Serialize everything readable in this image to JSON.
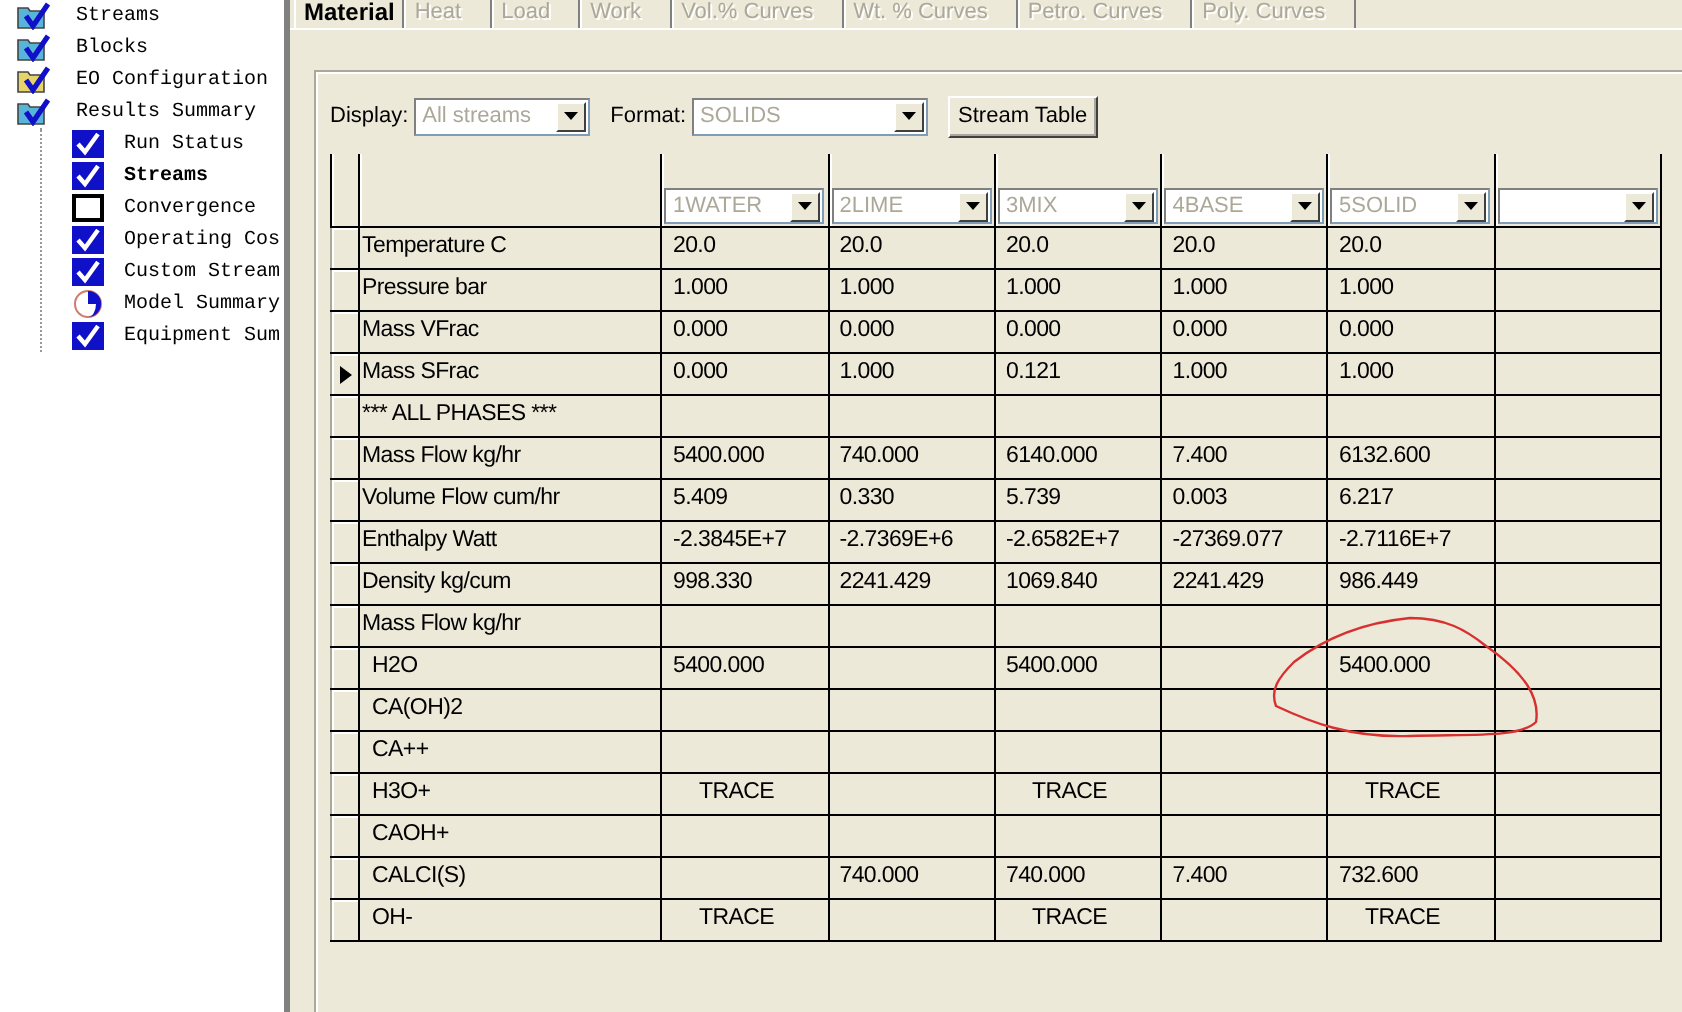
{
  "tree": [
    {
      "label": "Streams",
      "color": "#58b4d8",
      "checked": true,
      "selected": false
    },
    {
      "label": "Blocks",
      "color": "#58b4d8",
      "checked": true,
      "selected": false
    },
    {
      "label": "EO Configuration",
      "color": "#e6d46a",
      "checked": true,
      "selected": false
    },
    {
      "label": "Results Summary",
      "color": "#58b4d8",
      "checked": true,
      "selected": false,
      "children": [
        {
          "label": "Run Status",
          "checked": true,
          "partial": false,
          "selected": false
        },
        {
          "label": "Streams",
          "checked": true,
          "partial": false,
          "selected": true
        },
        {
          "label": "Convergence",
          "checked": false,
          "partial": false,
          "selected": false
        },
        {
          "label": "Operating Cos",
          "checked": true,
          "partial": false,
          "selected": false
        },
        {
          "label": "Custom Stream",
          "checked": true,
          "partial": false,
          "selected": false
        },
        {
          "label": "Model Summary",
          "checked": false,
          "partial": true,
          "selected": false
        },
        {
          "label": "Equipment Sum",
          "checked": true,
          "partial": false,
          "selected": false
        }
      ]
    }
  ],
  "tabs": [
    {
      "label": "Material",
      "selected": true,
      "disabled": false
    },
    {
      "label": "Heat",
      "selected": false,
      "disabled": true
    },
    {
      "label": "Load",
      "selected": false,
      "disabled": true
    },
    {
      "label": "Work",
      "selected": false,
      "disabled": true
    },
    {
      "label": "Vol.% Curves",
      "selected": false,
      "disabled": true
    },
    {
      "label": "Wt. % Curves",
      "selected": false,
      "disabled": true
    },
    {
      "label": "Petro. Curves",
      "selected": false,
      "disabled": true
    },
    {
      "label": "Poly. Curves",
      "selected": false,
      "disabled": true
    }
  ],
  "display": {
    "label": "Display:",
    "value": "All streams",
    "disabled": true
  },
  "format": {
    "label": "Format:",
    "value": "SOLIDS",
    "disabled": true
  },
  "stream_table_button": "Stream Table",
  "table": {
    "columns": [
      {
        "stream": "1WATER"
      },
      {
        "stream": "2LIME"
      },
      {
        "stream": "3MIX"
      },
      {
        "stream": "4BASE"
      },
      {
        "stream": "5SOLID"
      },
      {}
    ],
    "rows": [
      {
        "label": "Temperature C",
        "selected": false,
        "cells": [
          "20.0",
          "20.0",
          "20.0",
          "20.0",
          "20.0",
          null
        ]
      },
      {
        "label": "Pressure bar",
        "selected": false,
        "cells": [
          "1.000",
          "1.000",
          "1.000",
          "1.000",
          "1.000",
          null
        ]
      },
      {
        "label": "Mass VFrac",
        "selected": false,
        "cells": [
          "0.000",
          "0.000",
          "0.000",
          "0.000",
          "0.000",
          null
        ]
      },
      {
        "label": "Mass SFrac",
        "selected": true,
        "cells": [
          "0.000",
          "1.000",
          "0.121",
          "1.000",
          "1.000",
          null
        ]
      },
      {
        "label": "*** ALL PHASES ***",
        "selected": false,
        "cells": [
          null,
          null,
          null,
          null,
          null,
          null
        ]
      },
      {
        "label": "Mass Flow kg/hr",
        "selected": false,
        "cells": [
          "5400.000",
          "740.000",
          "6140.000",
          "7.400",
          "6132.600",
          null
        ]
      },
      {
        "label": "Volume Flow cum/hr",
        "selected": false,
        "cells": [
          "5.409",
          "0.330",
          "5.739",
          "0.003",
          "6.217",
          null
        ]
      },
      {
        "label": "Enthalpy Watt",
        "selected": false,
        "cells": [
          "-2.3845E+7",
          "-2.7369E+6",
          "-2.6582E+7",
          "-27369.077",
          "-2.7116E+7",
          null
        ]
      },
      {
        "label": "Density kg/cum",
        "selected": false,
        "cells": [
          "998.330",
          "2241.429",
          "1069.840",
          "2241.429",
          "986.449",
          null
        ]
      },
      {
        "label": "Mass Flow kg/hr",
        "selected": false,
        "cells": [
          null,
          null,
          null,
          null,
          null,
          null
        ],
        "children": [
          {
            "label": "H2O",
            "selected": false,
            "cells": [
              "5400.000",
              null,
              "5400.000",
              null,
              "5400.000",
              null
            ]
          },
          {
            "label": "CA(OH)2",
            "selected": false,
            "cells": [
              null,
              null,
              null,
              null,
              null,
              null
            ]
          },
          {
            "label": "CA++",
            "selected": false,
            "cells": [
              null,
              null,
              null,
              null,
              null,
              null
            ]
          },
          {
            "label": "H3O+",
            "selected": false,
            "cells": [
              "TRACE",
              null,
              "TRACE",
              null,
              "TRACE",
              null
            ]
          },
          {
            "label": "CAOH+",
            "selected": false,
            "cells": [
              null,
              null,
              null,
              null,
              null,
              null
            ]
          },
          {
            "label": "CALCI(S)",
            "selected": false,
            "cells": [
              null,
              "740.000",
              "740.000",
              "7.400",
              "732.600",
              null
            ]
          },
          {
            "label": "OH-",
            "selected": false,
            "cells": [
              "TRACE",
              null,
              "TRACE",
              null,
              "TRACE",
              null
            ]
          }
        ]
      }
    ]
  }
}
